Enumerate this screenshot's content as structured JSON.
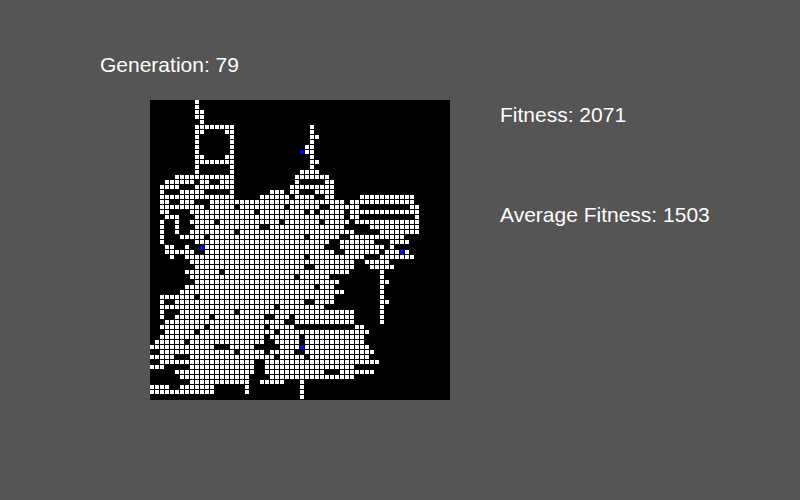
{
  "header": {
    "generation": "Generation: 79"
  },
  "stats": [
    {
      "label": "Fitness: 2071"
    },
    {
      "label": "Average Fitness: 1503"
    }
  ],
  "grid": {
    "rows": [
      [
        [
          9,
          9
        ]
      ],
      [
        [
          9,
          9
        ]
      ],
      [
        [
          9,
          10
        ]
      ],
      [
        [
          9,
          10
        ]
      ],
      [
        [
          10,
          10
        ]
      ],
      [
        [
          9,
          16
        ],
        [
          32,
          32
        ]
      ],
      [
        [
          9,
          10
        ],
        [
          15,
          16
        ],
        [
          32,
          32
        ]
      ],
      [
        [
          9,
          9
        ],
        [
          16,
          16
        ],
        [
          32,
          33
        ]
      ],
      [
        [
          9,
          9
        ],
        [
          16,
          16
        ],
        [
          32,
          32
        ]
      ],
      [
        [
          9,
          9
        ],
        [
          16,
          16
        ],
        [
          31,
          32
        ]
      ],
      [
        [
          9,
          9
        ],
        [
          16,
          16
        ],
        [
          30,
          32
        ]
      ],
      [
        [
          9,
          10
        ],
        [
          15,
          16
        ],
        [
          32,
          32
        ]
      ],
      [
        [
          9,
          16
        ],
        [
          32,
          33
        ]
      ],
      [
        [
          9,
          9
        ],
        [
          16,
          16
        ],
        [
          32,
          32
        ]
      ],
      [
        [
          9,
          9
        ],
        [
          16,
          16
        ],
        [
          30,
          33
        ]
      ],
      [
        [
          5,
          16
        ],
        [
          29,
          35
        ]
      ],
      [
        [
          3,
          8
        ],
        [
          10,
          11
        ],
        [
          14,
          16
        ],
        [
          29,
          29
        ],
        [
          35,
          36
        ]
      ],
      [
        [
          2,
          5
        ],
        [
          9,
          16
        ],
        [
          28,
          36
        ]
      ],
      [
        [
          2,
          2
        ],
        [
          6,
          10
        ],
        [
          16,
          16
        ],
        [
          24,
          26
        ],
        [
          28,
          29
        ],
        [
          33,
          36
        ]
      ],
      [
        [
          2,
          16
        ],
        [
          22,
          27
        ],
        [
          29,
          32
        ],
        [
          35,
          36
        ],
        [
          42,
          52
        ]
      ],
      [
        [
          2,
          3
        ],
        [
          6,
          8
        ],
        [
          12,
          38
        ],
        [
          40,
          52
        ]
      ],
      [
        [
          2,
          10
        ],
        [
          12,
          16
        ],
        [
          18,
          26
        ],
        [
          28,
          33
        ],
        [
          36,
          41
        ],
        [
          52,
          53
        ]
      ],
      [
        [
          2,
          3
        ],
        [
          8,
          20
        ],
        [
          22,
          30
        ],
        [
          32,
          32
        ],
        [
          34,
          38
        ],
        [
          40,
          53
        ]
      ],
      [
        [
          3,
          5
        ],
        [
          9,
          38
        ],
        [
          40,
          41
        ],
        [
          53,
          53
        ]
      ],
      [
        [
          2,
          2
        ],
        [
          5,
          5
        ],
        [
          8,
          12
        ],
        [
          14,
          25
        ],
        [
          27,
          33
        ],
        [
          35,
          39
        ],
        [
          41,
          53
        ]
      ],
      [
        [
          2,
          2
        ],
        [
          5,
          5
        ],
        [
          9,
          21
        ],
        [
          24,
          38
        ],
        [
          44,
          53
        ]
      ],
      [
        [
          2,
          2
        ],
        [
          5,
          5
        ],
        [
          8,
          16
        ],
        [
          18,
          40
        ],
        [
          46,
          53
        ]
      ],
      [
        [
          2,
          2
        ],
        [
          6,
          10
        ],
        [
          12,
          30
        ],
        [
          32,
          37
        ],
        [
          40,
          50
        ]
      ],
      [
        [
          2,
          2
        ],
        [
          9,
          35
        ],
        [
          38,
          44
        ],
        [
          48,
          51
        ]
      ],
      [
        [
          3,
          4
        ],
        [
          7,
          7
        ],
        [
          10,
          34
        ],
        [
          38,
          46
        ],
        [
          48,
          48
        ]
      ],
      [
        [
          3,
          8
        ],
        [
          11,
          36
        ],
        [
          39,
          45
        ],
        [
          47,
          51
        ]
      ],
      [
        [
          4,
          4
        ],
        [
          7,
          30
        ],
        [
          32,
          42
        ],
        [
          46,
          52
        ]
      ],
      [
        [
          8,
          40
        ],
        [
          43,
          47
        ]
      ],
      [
        [
          9,
          30
        ],
        [
          33,
          40
        ],
        [
          44,
          48
        ]
      ],
      [
        [
          7,
          13
        ],
        [
          15,
          39
        ],
        [
          46,
          46
        ]
      ],
      [
        [
          8,
          28
        ],
        [
          30,
          35
        ],
        [
          46,
          46
        ]
      ],
      [
        [
          9,
          37
        ],
        [
          46,
          47
        ]
      ],
      [
        [
          7,
          32
        ],
        [
          34,
          36
        ],
        [
          46,
          46
        ]
      ],
      [
        [
          6,
          38
        ],
        [
          46,
          46
        ]
      ],
      [
        [
          2,
          8
        ],
        [
          10,
          36
        ],
        [
          46,
          46
        ]
      ],
      [
        [
          2,
          2
        ],
        [
          5,
          30
        ],
        [
          33,
          36
        ],
        [
          46,
          47
        ]
      ],
      [
        [
          2,
          24
        ],
        [
          26,
          34
        ],
        [
          46,
          46
        ]
      ],
      [
        [
          2,
          2
        ],
        [
          6,
          16
        ],
        [
          18,
          40
        ],
        [
          46,
          46
        ]
      ],
      [
        [
          2,
          2
        ],
        [
          5,
          11
        ],
        [
          13,
          22
        ],
        [
          25,
          27
        ],
        [
          29,
          40
        ],
        [
          46,
          46
        ]
      ],
      [
        [
          3,
          26
        ],
        [
          29,
          40
        ],
        [
          46,
          46
        ]
      ],
      [
        [
          2,
          10
        ],
        [
          12,
          22
        ],
        [
          24,
          28
        ],
        [
          41,
          42
        ]
      ],
      [
        [
          3,
          8
        ],
        [
          10,
          24
        ],
        [
          26,
          43
        ]
      ],
      [
        [
          2,
          22
        ],
        [
          24,
          29
        ],
        [
          31,
          42
        ]
      ],
      [
        [
          1,
          6
        ],
        [
          8,
          22
        ],
        [
          25,
          29
        ],
        [
          31,
          42
        ]
      ],
      [
        [
          0,
          12
        ],
        [
          16,
          20
        ],
        [
          26,
          43
        ]
      ],
      [
        [
          2,
          16
        ],
        [
          18,
          22
        ],
        [
          24,
          28
        ],
        [
          31,
          44
        ]
      ],
      [
        [
          0,
          4
        ],
        [
          8,
          24
        ],
        [
          26,
          30
        ],
        [
          32,
          43
        ]
      ],
      [
        [
          2,
          20
        ],
        [
          23,
          45
        ]
      ],
      [
        [
          0,
          2
        ],
        [
          8,
          20
        ],
        [
          23,
          40
        ]
      ],
      [
        [
          5,
          20
        ],
        [
          23,
          34
        ],
        [
          38,
          44
        ]
      ],
      [
        [
          6,
          19
        ],
        [
          24,
          40
        ]
      ],
      [
        [
          8,
          19
        ],
        [
          22,
          26
        ],
        [
          30,
          30
        ]
      ],
      [
        [
          0,
          3
        ],
        [
          6,
          12
        ],
        [
          19,
          19
        ],
        [
          30,
          30
        ]
      ],
      [
        [
          0,
          12
        ],
        [
          19,
          19
        ],
        [
          30,
          30
        ]
      ],
      [
        [
          30,
          30
        ]
      ]
    ],
    "agents": [
      {
        "row": 10,
        "col": 30
      },
      {
        "row": 29,
        "col": 10
      },
      {
        "row": 30,
        "col": 50
      },
      {
        "row": 49,
        "col": 30
      }
    ]
  }
}
